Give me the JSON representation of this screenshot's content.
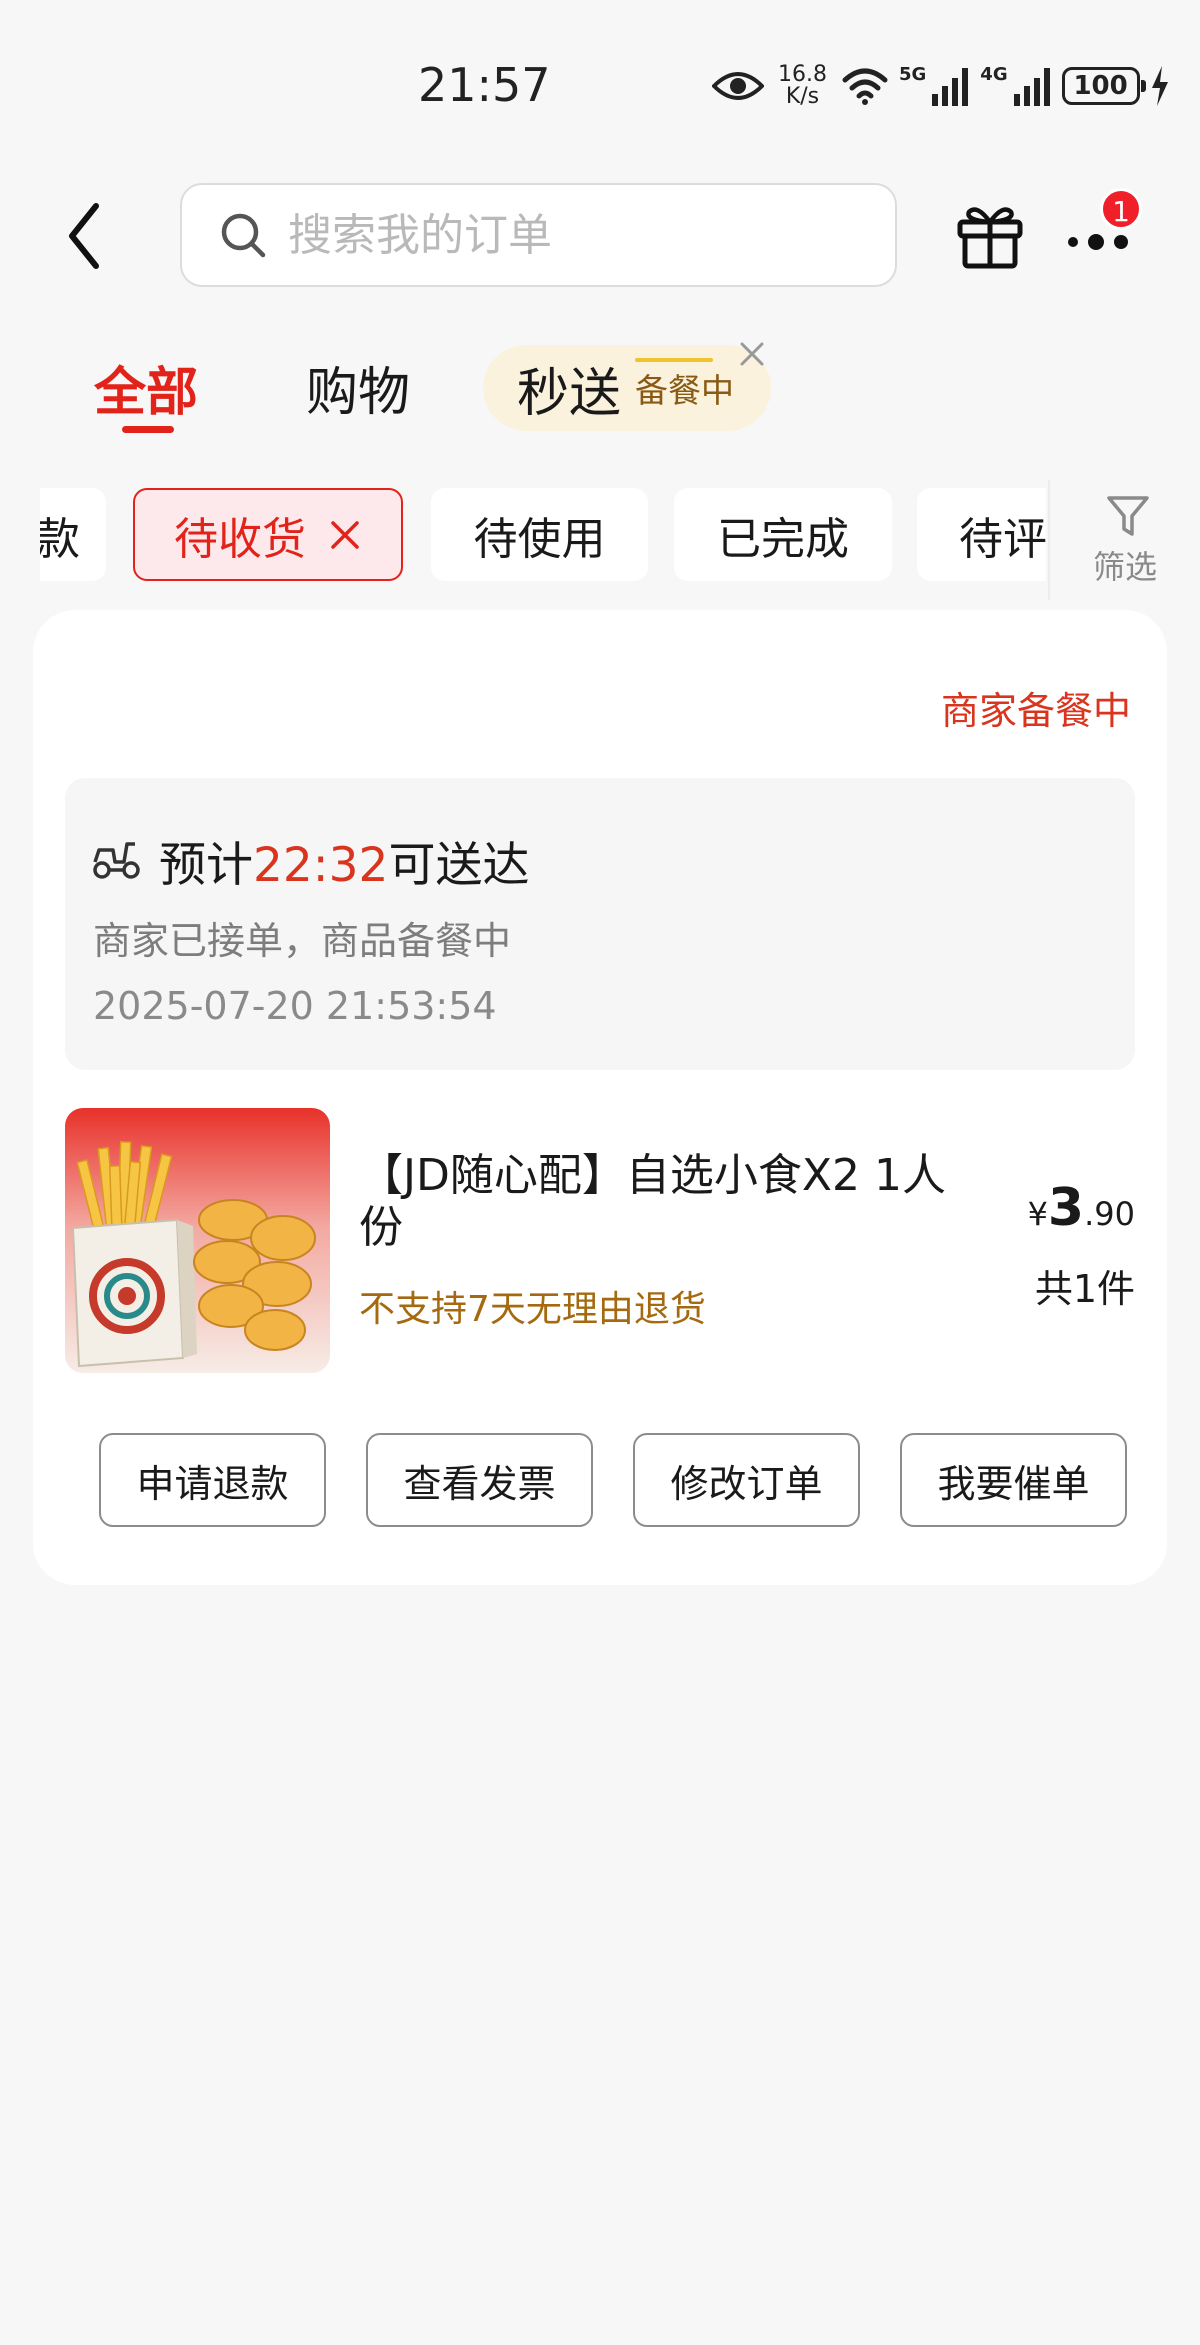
{
  "status_bar": {
    "time": "21:57",
    "net_speed_value": "16.8",
    "net_speed_unit": "K/s",
    "sig1_label": "5G",
    "sig2_label": "4G",
    "battery": "100",
    "icons": [
      "eye-icon",
      "wifi-icon",
      "signal-icon",
      "charging-icon"
    ]
  },
  "header": {
    "search_placeholder": "搜索我的订单",
    "badge_count": "1",
    "icons": [
      "back-icon",
      "search-icon",
      "gift-icon",
      "more-icon"
    ]
  },
  "tabs": {
    "all": "全部",
    "shopping": "购物",
    "flash": "秒送",
    "flash_status": "备餐中"
  },
  "filters": {
    "partial_left": "款",
    "items": [
      "待收货",
      "待使用",
      "已完成",
      "待评"
    ],
    "active_index": 0,
    "filter_label": "筛选"
  },
  "order": {
    "status": "商家备餐中",
    "eta_prefix": "预计",
    "eta_time": "22:32",
    "eta_suffix": "可送达",
    "message": "商家已接单，商品备餐中",
    "timestamp": "2025-07-20 21:53:54",
    "product_title": "【JD随心配】自选小食X2 1人份",
    "product_note": "不支持7天无理由退货",
    "price_symbol": "¥",
    "price_int": "3",
    "price_dec": ".90",
    "quantity": "共1件",
    "actions": [
      "申请退款",
      "查看发票",
      "修改订单",
      "我要催单"
    ]
  },
  "colors": {
    "accent": "#e2231a",
    "status_orange": "#d9351e",
    "note_brown": "#a56a10",
    "flash_bg": "#fbf2de"
  }
}
